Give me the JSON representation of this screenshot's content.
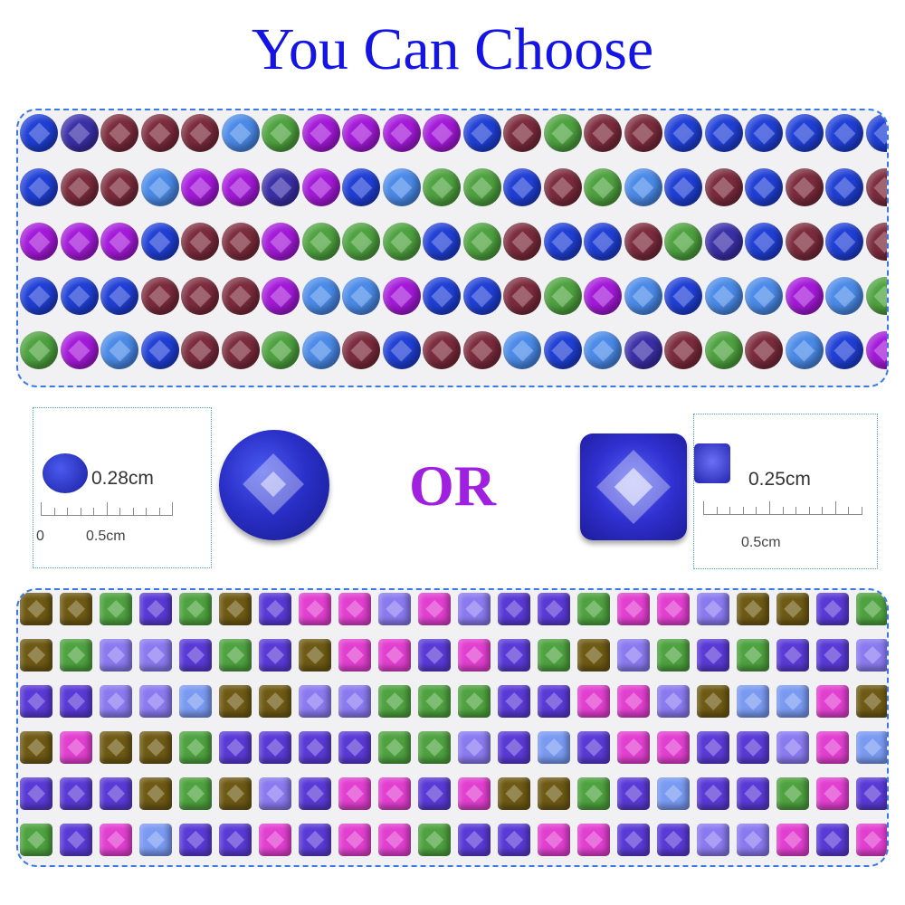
{
  "title": "You Can Choose",
  "round_option": {
    "size_label": "0.28cm",
    "scale_start": "0",
    "scale_label": "0.5cm"
  },
  "separator": "OR",
  "square_option": {
    "size_label": "0.25cm",
    "scale_label": "0.5cm"
  },
  "colors": {
    "title": "#1414e6",
    "or": "#a020e0",
    "panel_border": "#3b78e7",
    "round_palette": [
      "#1f3fd6",
      "#7b2b3c",
      "#a419d9",
      "#4a8ae8",
      "#4ea23f",
      "#3b2fa8"
    ],
    "square_palette": [
      "#6e5a14",
      "#4ea23f",
      "#5a3ad6",
      "#e23fd0",
      "#8a7af0",
      "#7a9af2"
    ]
  },
  "gem_rows": {
    "round": [
      [
        0,
        5,
        1,
        1,
        1,
        3,
        4,
        2,
        2,
        2,
        2,
        0,
        1,
        4,
        1,
        1,
        0,
        0,
        0,
        0,
        0,
        0
      ],
      [
        0,
        1,
        1,
        3,
        2,
        2,
        5,
        2,
        0,
        3,
        4,
        4,
        0,
        1,
        4,
        3,
        0,
        1,
        0,
        1,
        0,
        1
      ],
      [
        2,
        2,
        2,
        0,
        1,
        1,
        2,
        4,
        4,
        4,
        0,
        4,
        1,
        0,
        0,
        1,
        4,
        5,
        0,
        1,
        0,
        1
      ],
      [
        0,
        0,
        0,
        1,
        1,
        1,
        2,
        3,
        3,
        2,
        0,
        0,
        1,
        4,
        2,
        3,
        0,
        3,
        3,
        2,
        3,
        4
      ],
      [
        4,
        2,
        3,
        0,
        1,
        1,
        4,
        3,
        1,
        0,
        1,
        1,
        3,
        0,
        3,
        5,
        1,
        4,
        1,
        3,
        0,
        2
      ]
    ],
    "square": [
      [
        0,
        0,
        1,
        2,
        1,
        0,
        2,
        3,
        3,
        4,
        3,
        4,
        2,
        2,
        1,
        3,
        3,
        4,
        0,
        0,
        2,
        1
      ],
      [
        0,
        1,
        4,
        4,
        2,
        1,
        2,
        0,
        3,
        3,
        2,
        3,
        2,
        1,
        0,
        4,
        1,
        2,
        1,
        2,
        2,
        4
      ],
      [
        2,
        2,
        4,
        4,
        5,
        0,
        0,
        4,
        4,
        1,
        1,
        1,
        2,
        2,
        3,
        3,
        4,
        0,
        5,
        5,
        3,
        0
      ],
      [
        0,
        3,
        0,
        0,
        1,
        2,
        2,
        2,
        2,
        1,
        1,
        4,
        2,
        5,
        2,
        3,
        3,
        2,
        2,
        4,
        3,
        5
      ],
      [
        2,
        2,
        2,
        0,
        1,
        0,
        4,
        2,
        3,
        3,
        2,
        3,
        0,
        0,
        1,
        2,
        5,
        2,
        2,
        1,
        3,
        2
      ],
      [
        1,
        2,
        3,
        5,
        2,
        2,
        3,
        2,
        3,
        3,
        1,
        2,
        2,
        3,
        3,
        2,
        2,
        4,
        4,
        3,
        2,
        3
      ]
    ]
  }
}
